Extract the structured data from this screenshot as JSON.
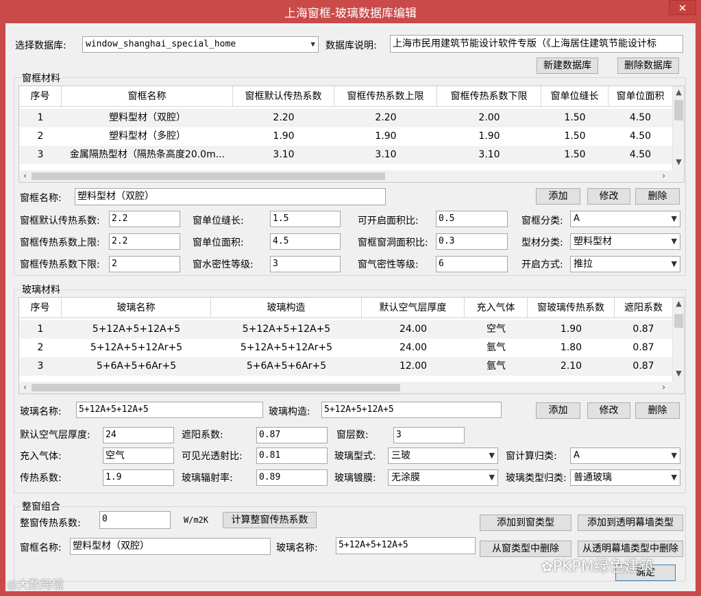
{
  "window": {
    "title": "上海窗框-玻璃数据库编辑",
    "close": "✕"
  },
  "top": {
    "db_label": "选择数据库:",
    "db_value": "window_shanghai_special_home",
    "desc_label": "数据库说明:",
    "desc_value": "上海市民用建筑节能设计软件专版（《上海居住建筑节能设计标",
    "new_db": "新建数据库",
    "delete_db": "删除数据库"
  },
  "frame": {
    "group_title": "窗框材料",
    "headers": [
      "序号",
      "窗框名称",
      "窗框默认传热系数",
      "窗框传热系数上限",
      "窗框传热系数下限",
      "窗单位缝长",
      "窗单位面积"
    ],
    "rows": [
      [
        "1",
        "塑料型材（双腔）",
        "2.20",
        "2.20",
        "2.00",
        "1.50",
        "4.50"
      ],
      [
        "2",
        "塑料型材（多腔）",
        "1.90",
        "1.90",
        "1.90",
        "1.50",
        "4.50"
      ],
      [
        "3",
        "金属隔热型材（隔热条高度20.0m...",
        "3.10",
        "3.10",
        "3.10",
        "1.50",
        "4.50"
      ]
    ],
    "name_label": "窗框名称:",
    "name_value": "塑料型材（双腔）",
    "add": "添加",
    "modify": "修改",
    "delete": "删除",
    "default_k_label": "窗框默认传热系数:",
    "default_k": "2.2",
    "k_upper_label": "窗框传热系数上限:",
    "k_upper": "2.2",
    "k_lower_label": "窗框传热系数下限:",
    "k_lower": "2",
    "unit_len_label": "窗单位缝长:",
    "unit_len": "1.5",
    "unit_area_label": "窗单位面积:",
    "unit_area": "4.5",
    "water_label": "窗水密性等级:",
    "water": "3",
    "open_ratio_label": "可开启面积比:",
    "open_ratio": "0.5",
    "hole_ratio_label": "窗框窗洞面积比:",
    "hole_ratio": "0.3",
    "air_label": "窗气密性等级:",
    "air": "6",
    "class_label": "窗框分类:",
    "class_value": "A",
    "profile_label": "型材分类:",
    "profile_value": "塑料型材",
    "open_label": "开启方式:",
    "open_value": "推拉"
  },
  "glass": {
    "group_title": "玻璃材料",
    "headers": [
      "序号",
      "玻璃名称",
      "玻璃构造",
      "默认空气层厚度",
      "充入气体",
      "窗玻璃传热系数",
      "遮阳系数"
    ],
    "rows": [
      [
        "1",
        "5+12A+5+12A+5",
        "5+12A+5+12A+5",
        "24.00",
        "空气",
        "1.90",
        "0.87"
      ],
      [
        "2",
        "5+12A+5+12Ar+5",
        "5+12A+5+12Ar+5",
        "24.00",
        "氩气",
        "1.80",
        "0.87"
      ],
      [
        "3",
        "5+6A+5+6Ar+5",
        "5+6A+5+6Ar+5",
        "12.00",
        "氩气",
        "2.10",
        "0.87"
      ]
    ],
    "name_label": "玻璃名称:",
    "name_value": "5+12A+5+12A+5",
    "struct_label": "玻璃构造:",
    "struct_value": "5+12A+5+12A+5",
    "add": "添加",
    "modify": "修改",
    "delete": "删除",
    "air_thick_label": "默认空气层厚度:",
    "air_thick": "24",
    "shade_label": "遮阳系数:",
    "shade": "0.87",
    "layers_label": "窗层数:",
    "layers": "3",
    "gas_label": "充入气体:",
    "gas": "空气",
    "visible_label": "可见光透射比:",
    "visible": "0.81",
    "type_label": "玻璃型式:",
    "type_value": "三玻",
    "calc_label": "窗计算归类:",
    "calc_value": "A",
    "k_label": "传热系数:",
    "k": "1.9",
    "emiss_label": "玻璃辐射率:",
    "emiss": "0.89",
    "coat_label": "玻璃镀膜:",
    "coat_value": "无涂膜",
    "glass_type_label": "玻璃类型归类:",
    "glass_type_value": "普通玻璃"
  },
  "whole": {
    "group_title": "整窗组合",
    "k_label": "整窗传热系数:",
    "k": "0",
    "unit": "W/m2K",
    "calc_btn": "计算整窗传热系数",
    "add_window": "添加到窗类型",
    "add_curtain": "添加到透明幕墙类型",
    "frame_label": "窗框名称:",
    "frame_value": "塑料型材（双腔）",
    "glass_label": "玻璃名称:",
    "glass_value": "5+12A+5+12A+5",
    "del_window": "从窗类型中删除",
    "del_curtain": "从透明幕墙类型中删除",
    "ok": "确定"
  },
  "watermarks": {
    "left": "大数跨境",
    "right": "PKPM绿色建筑"
  }
}
